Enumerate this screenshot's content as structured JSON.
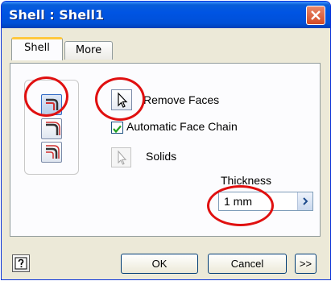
{
  "window": {
    "title": "Shell : Shell1"
  },
  "tabs": [
    {
      "label": "Shell",
      "active": true
    },
    {
      "label": "More",
      "active": false
    }
  ],
  "shell": {
    "remove_faces_label": "Remove Faces",
    "automatic_face_chain_label": "Automatic Face Chain",
    "automatic_face_chain_checked": true,
    "solids_label": "Solids",
    "thickness_label": "Thickness",
    "thickness_value": "1 mm"
  },
  "footer": {
    "ok_label": "OK",
    "cancel_label": "Cancel",
    "more_label": ">>"
  },
  "colors": {
    "title_bar": "#0054e3",
    "annotation_ring": "#e01010",
    "tab_highlight": "#ffc83c"
  },
  "icons": [
    "close-icon",
    "shell-inside-icon",
    "shell-outside-icon",
    "shell-both-icon",
    "cursor-select-icon",
    "help-icon",
    "spin-arrow-icon"
  ]
}
